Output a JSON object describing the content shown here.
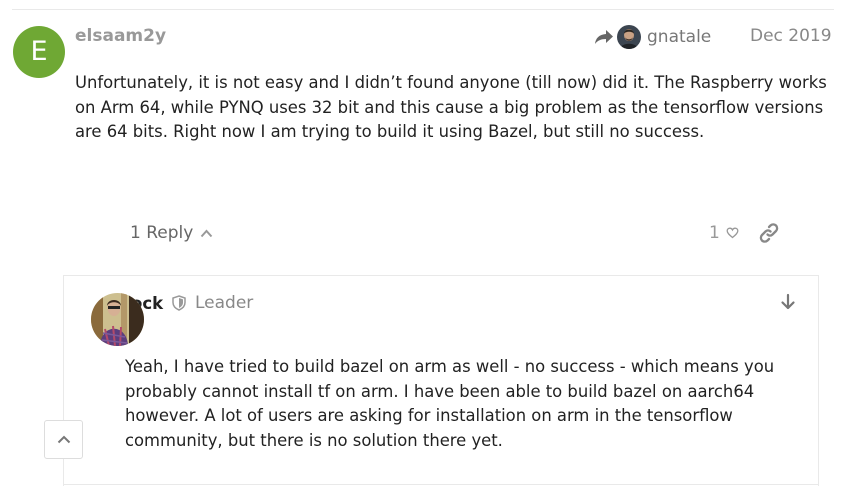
{
  "post": {
    "avatar_letter": "E",
    "avatar_color": "#6fa834",
    "username": "elsaam2y",
    "reply_to_name": "gnatale",
    "date": "Dec 2019",
    "body": "Unfortunately, it is not easy and I didn’t found anyone (till now) did it. The Raspberry works on Arm 64, while PYNQ uses 32 bit and this cause a big problem as the tensorflow versions are 64 bits. Right now I am trying to build it using Bazel, but still no success.",
    "replies_label": "1 Reply",
    "likes": "1"
  },
  "embedded_reply": {
    "username_visible": "ock",
    "title": "Leader",
    "body": "Yeah, I have tried to build bazel on arm as well - no success - which means you probably cannot install tf on arm. I have been able to build bazel on aarch64 however. A lot of users are asking for installation on arm in the tensorflow community, but there is no solution there yet."
  },
  "icons": {
    "reply_arrow": "share-arrow-icon",
    "chevron_up": "chevron-up-icon",
    "heart": "heart-icon",
    "link": "link-icon",
    "shield": "shield-icon",
    "arrow_down": "arrow-down-icon",
    "scroll_top": "chevron-up-icon"
  }
}
